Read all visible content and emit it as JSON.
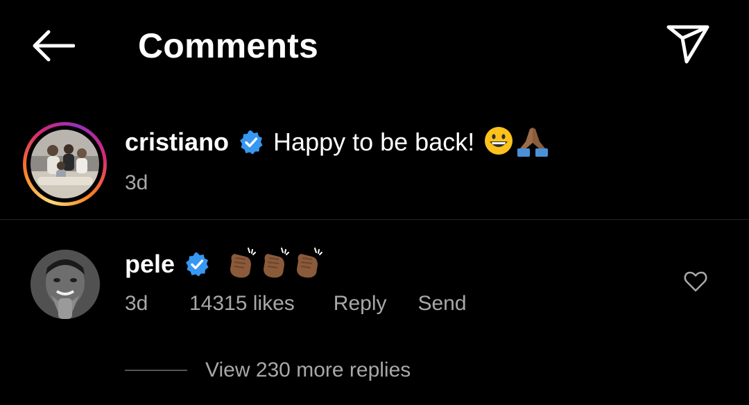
{
  "header": {
    "title": "Comments",
    "back_icon": "back-arrow-icon",
    "share_icon": "send-direct-icon"
  },
  "caption": {
    "username": "cristiano",
    "verified": true,
    "text": "Happy to be back!",
    "emojis": [
      "grinning-face-emoji",
      "folded-hands-emoji"
    ],
    "time": "3d",
    "story_ring": true
  },
  "comment": {
    "username": "pele",
    "verified": true,
    "emojis": [
      "clapping-hands-emoji",
      "clapping-hands-emoji",
      "clapping-hands-emoji"
    ],
    "time": "3d",
    "likes": "14315 likes",
    "reply_label": "Reply",
    "send_label": "Send",
    "like_icon": "heart-outline-icon"
  },
  "replies": {
    "label": "View 230 more replies"
  },
  "colors": {
    "background": "#000000",
    "text_primary": "#ffffff",
    "text_secondary": "#a8a8a8",
    "verified_badge": "#3897f0",
    "divider": "#262626"
  }
}
